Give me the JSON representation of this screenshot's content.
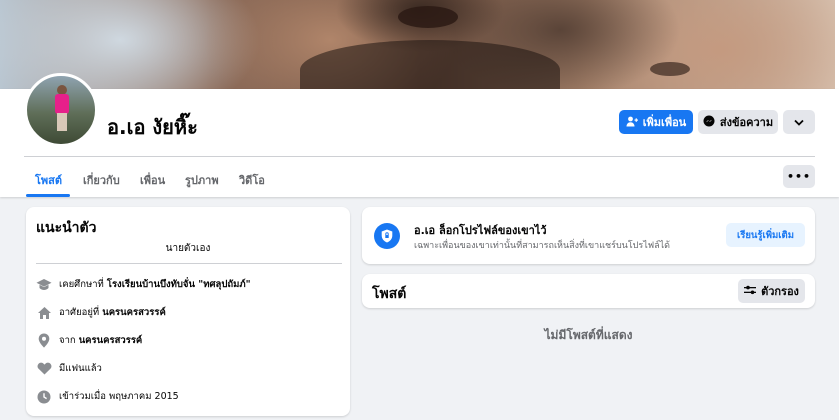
{
  "profile": {
    "name": "อ.เอ งัยหิ๊ะ"
  },
  "actions": {
    "add_friend": "เพิ่มเพื่อน",
    "message": "ส่งข้อความ"
  },
  "tabs": [
    {
      "label": "โพสต์",
      "active": true
    },
    {
      "label": "เกี่ยวกับ",
      "active": false
    },
    {
      "label": "เพื่อน",
      "active": false
    },
    {
      "label": "รูปภาพ",
      "active": false
    },
    {
      "label": "วิดีโอ",
      "active": false
    }
  ],
  "intro": {
    "title": "แนะนำตัว",
    "bio": "นายตัวเอง",
    "items": [
      {
        "icon": "graduation-cap-icon",
        "prefix": "เคยศึกษาที่ ",
        "bold": "โรงเรียนบ้านบึงทับจั่น \"ทศลุปถัมภ์\""
      },
      {
        "icon": "home-icon",
        "prefix": "อาศัยอยู่ที่ ",
        "bold": "นครนครสวรรค์"
      },
      {
        "icon": "location-pin-icon",
        "prefix": "จาก ",
        "bold": "นครนครสวรรค์"
      },
      {
        "icon": "heart-icon",
        "prefix": "มีแฟนแล้ว",
        "bold": ""
      },
      {
        "icon": "clock-icon",
        "prefix": "เข้าร่วมเมื่อ พฤษภาคม 2015",
        "bold": ""
      }
    ]
  },
  "locked": {
    "title": "อ.เอ ล็อกโปรไฟล์ของเขาไว้",
    "subtitle": "เฉพาะเพื่อนของเขาเท่านั้นที่สามารถเห็นสิ่งที่เขาแชร์บนโปรไฟล์ได้",
    "learn_more": "เรียนรู้เพิ่มเติม"
  },
  "posts": {
    "title": "โพสต์",
    "filter_label": "ตัวกรอง",
    "empty_text": "ไม่มีโพสต์ที่แสดง"
  },
  "colors": {
    "accent": "#1877f2",
    "background": "#f0f2f5"
  }
}
